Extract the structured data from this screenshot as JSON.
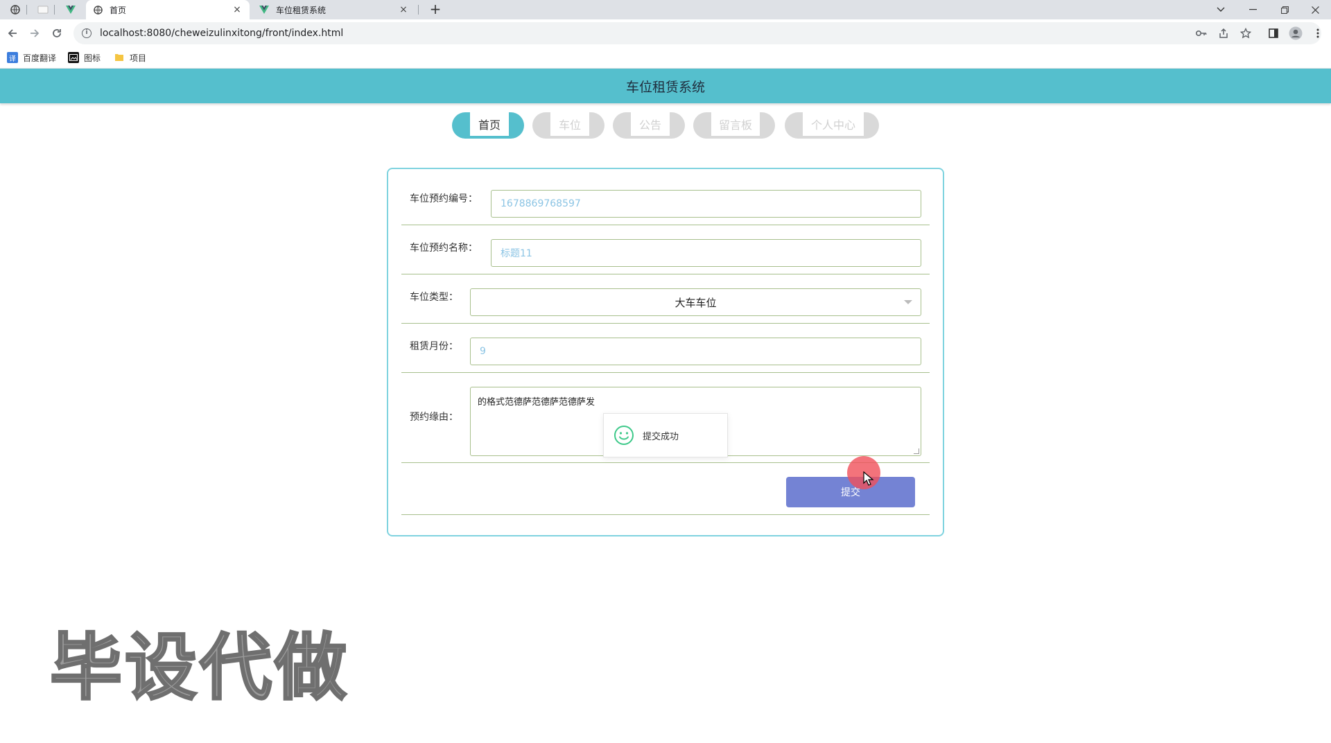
{
  "browser": {
    "tabs": [
      {
        "title": "首页",
        "active": true
      },
      {
        "title": "车位租赁系统",
        "active": false
      }
    ],
    "close_glyph": "×",
    "newtab_glyph": "+",
    "url": "localhost:8080/cheweizulinxitong/front/index.html",
    "bookmarks": [
      "百度翻译",
      "图标",
      "项目"
    ],
    "bookmark_icon_glyph": "译"
  },
  "header": {
    "title": "车位租赁系统",
    "color": "#55bfcd"
  },
  "nav": {
    "items": [
      {
        "label": "首页",
        "active": true
      },
      {
        "label": "车位",
        "active": false
      },
      {
        "label": "公告",
        "active": false
      },
      {
        "label": "留言板",
        "active": false
      },
      {
        "label": "个人中心",
        "active": false
      }
    ]
  },
  "form": {
    "fields": {
      "booking_no": {
        "label": "车位预约编号：",
        "value": "1678869768597"
      },
      "booking_name": {
        "label": "车位预约名称：",
        "value": "标题11"
      },
      "space_type": {
        "label": "车位类型：",
        "value": "大车车位"
      },
      "months": {
        "label": "租赁月份：",
        "value": "9"
      },
      "reason": {
        "label": "预约缘由：",
        "value": "的格式范德萨范德萨范德萨发"
      }
    },
    "submit_label": "提交"
  },
  "toast": {
    "message": "提交成功"
  },
  "watermark": "毕设代做"
}
